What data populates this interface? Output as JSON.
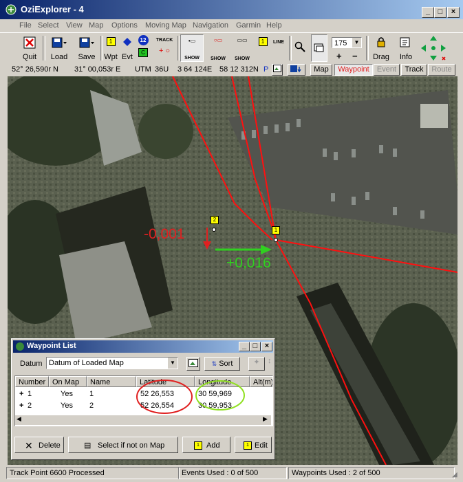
{
  "window": {
    "title": "OziExplorer - 4"
  },
  "menu": [
    "File",
    "Select",
    "View",
    "Map",
    "Options",
    "Moving Map",
    "Navigation",
    "Garmin",
    "Help"
  ],
  "toolbar": {
    "quit_label": "Quit",
    "load_label": "Load",
    "save_label": "Save",
    "wpt_label": "Wpt",
    "evt_label": "Evt",
    "track_label": "TRACK",
    "show_label": "SHOW",
    "line_label": "LINE",
    "zoom_value": "175",
    "drag_label": "Drag",
    "info_label": "Info",
    "badge_12": "12",
    "badge_1": "1",
    "badge_c": "C"
  },
  "coords": {
    "lat": "52° 26,590r N",
    "lon": "31° 00,053r E",
    "utm": "UTM",
    "zone": "36U",
    "easting": "3 64 124E",
    "northing": "58 12 312N",
    "p": "P",
    "tabs": [
      "Map",
      "Waypoint",
      "Event",
      "Track",
      "Route"
    ]
  },
  "map_annotations": {
    "lat_delta": "-0,001",
    "lon_delta": "+0,016",
    "wp1": "1",
    "wp2": "2"
  },
  "waypoint_list": {
    "title": "Waypoint List",
    "datum_label": "Datum",
    "datum_value": "Datum of Loaded Map",
    "sort_label": "Sort",
    "columns": [
      "Number",
      "On Map",
      "Name",
      "Latitude",
      "Longitude",
      "Alt(m)"
    ],
    "rows": [
      {
        "number": "1",
        "on_map": "Yes",
        "name": "1",
        "lat": "52 26,553",
        "lon": "30 59,969"
      },
      {
        "number": "2",
        "on_map": "Yes",
        "name": "2",
        "lat": "52 26,554",
        "lon": "30 59,953"
      }
    ],
    "buttons": {
      "delete": "Delete",
      "select": "Select if not on Map",
      "add": "Add",
      "edit": "Edit"
    }
  },
  "status": {
    "track": "Track Point 6600 Processed",
    "events": "Events Used : 0 of 500",
    "waypoints": "Waypoints Used : 2 of 500"
  },
  "colors": {
    "annotation_red": "#e02020",
    "annotation_green": "#30d020",
    "track_red": "#ff1010"
  }
}
